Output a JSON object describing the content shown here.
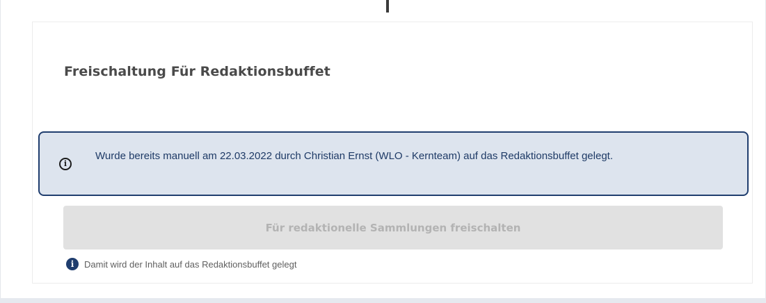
{
  "card": {
    "title": "Freischaltung Für Redaktionsbuffet"
  },
  "info_box": {
    "icon": "info-outline-icon",
    "text": "Wurde bereits manuell am 22.03.2022 durch Christian Ernst (WLO - Kernteam) auf das Redaktionsbuffet gelegt."
  },
  "unlock_button": {
    "label": "Für redaktionelle Sammlungen freischalten",
    "disabled": true
  },
  "hint": {
    "icon": "info-filled-icon",
    "text": "Damit wird der Inhalt auf das Redaktionsbuffet gelegt"
  },
  "colors": {
    "accent": "#1f3d6e",
    "info_background": "#dde4ee",
    "button_disabled_background": "#e1e1e1",
    "button_disabled_text": "#b3b3b3"
  }
}
